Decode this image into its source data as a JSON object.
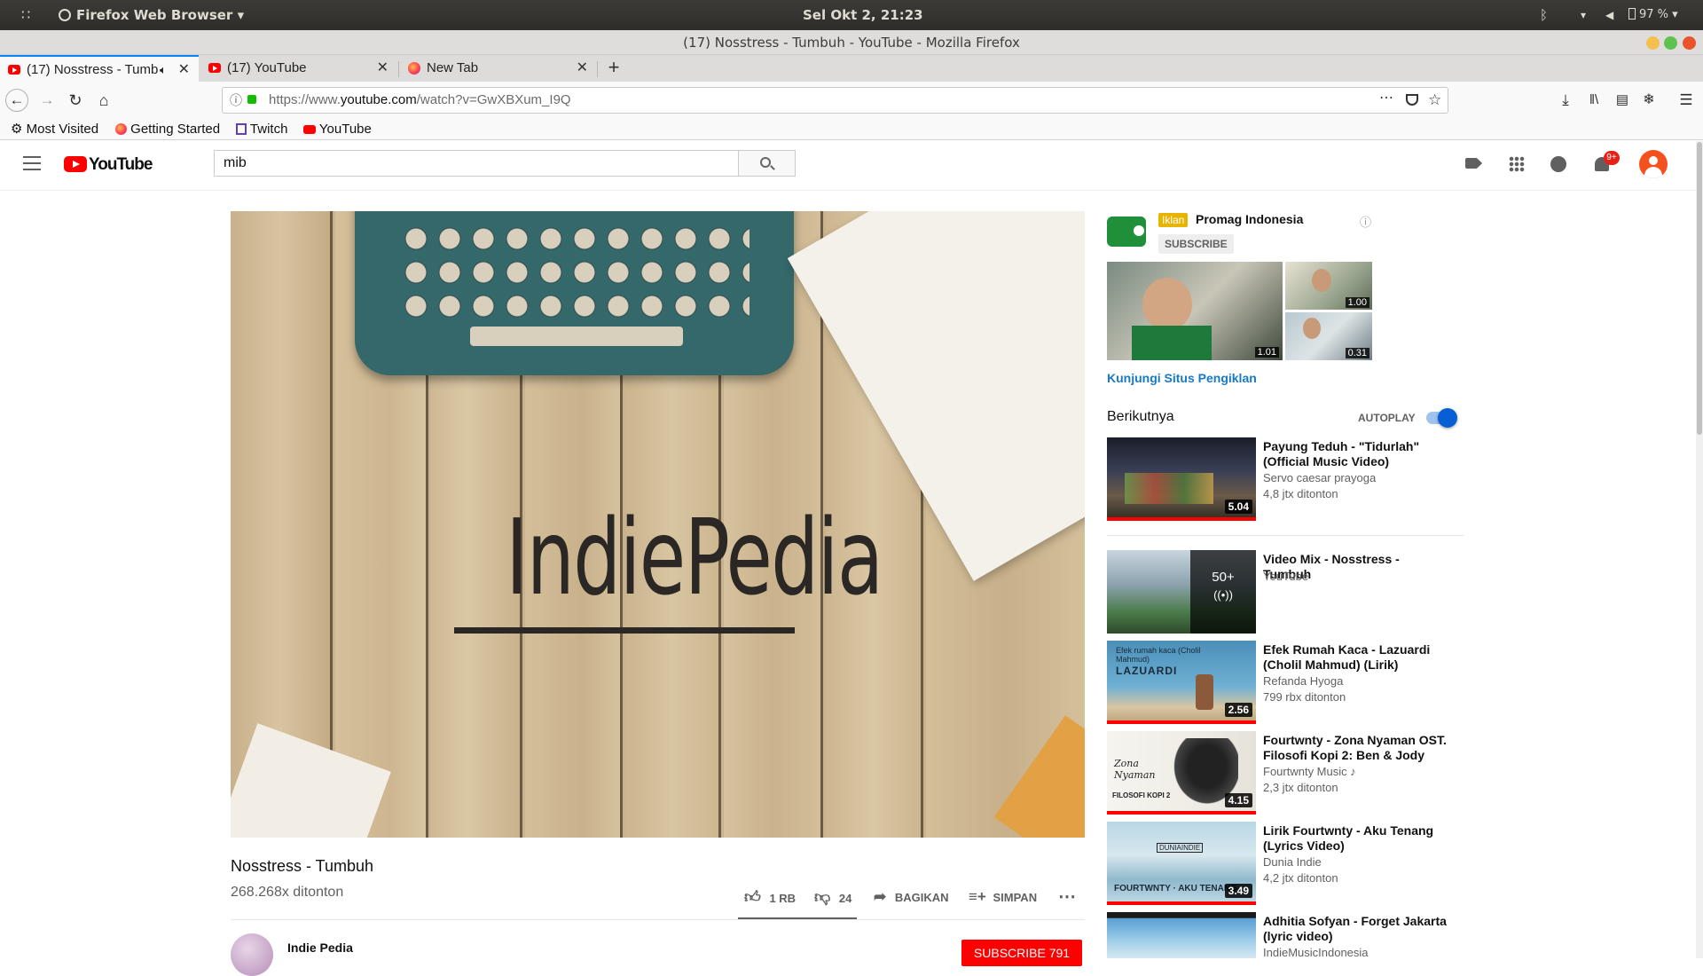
{
  "os_bar": {
    "app_menu": "Firefox Web Browser",
    "clock": "Sel Okt  2, 21:23",
    "battery": "97 %"
  },
  "window": {
    "title": "(17) Nosstress - Tumbuh - YouTube - Mozilla Firefox"
  },
  "tabs": [
    {
      "label": "(17) Nosstress - Tumb"
    },
    {
      "label": "(17) YouTube"
    },
    {
      "label": "New Tab"
    }
  ],
  "url": {
    "prefix": "https://www.",
    "domain": "youtube.com",
    "path": "/watch?v=GwXBXum_I9Q"
  },
  "bookmarks": [
    "Most Visited",
    "Getting Started",
    "Twitch",
    "YouTube"
  ],
  "youtube": {
    "logo": "YouTube",
    "search_value": "mib",
    "notif_count": "9+"
  },
  "video": {
    "overlay_text": "IndiePedia",
    "title": "Nosstress - Tumbuh",
    "views": "268.268x ditonton",
    "likes": "1 RB",
    "dislikes": "24",
    "share": "BAGIKAN",
    "save": "SIMPAN",
    "channel": "Indie Pedia",
    "subscribe": "SUBSCRIBE",
    "subscribers": "791"
  },
  "ad": {
    "badge": "Iklan",
    "advertiser": "Promag Indonesia",
    "subscribe": "SUBSCRIBE",
    "dur1": "1.01",
    "dur2": "1.00",
    "dur3": "0.31",
    "visit_link": "Kunjungi Situs Pengiklan"
  },
  "upnext": {
    "heading": "Berikutnya",
    "autoplay": "AUTOPLAY"
  },
  "recommendations": [
    {
      "title": "Payung Teduh - \"Tidurlah\" (Official Music Video)",
      "channel": "Servo caesar prayoga",
      "views": "4,8 jtx ditonton",
      "duration": "5.04"
    },
    {
      "title": "Video Mix - Nosstress - Tumbuh",
      "channel": "YouTube",
      "count": "50+"
    },
    {
      "title": "Efek Rumah Kaca - Lazuardi (Cholil Mahmud) (Lirik)",
      "channel": "Refanda Hyoga",
      "views": "799 rbx ditonton",
      "duration": "2.56"
    },
    {
      "title": "Fourtwnty - Zona Nyaman OST. Filosofi Kopi 2: Ben & Jody",
      "channel": "Fourtwnty Music",
      "views": "2,3 jtx ditonton",
      "duration": "4.15"
    },
    {
      "title": "Lirik Fourtwnty - Aku Tenang (Lyrics Video)",
      "channel": "Dunia Indie",
      "views": "4,2 jtx ditonton",
      "duration": "3.49"
    },
    {
      "title": "Adhitia Sofyan - Forget Jakarta (lyric video)",
      "channel": "IndieMusicIndonesia"
    }
  ],
  "thumb_text": {
    "lazuardi": "LAZUARDI",
    "lazuardi_small": "Efek rumah kaca (Cholil Mahmud)",
    "zona": "Zona Nyaman",
    "filosofi": "FILOSOFI KOPI 2",
    "aku_tenang": "FOURTWNTY · AKU TENANG",
    "dunia_indie": "DUNIAINDIE"
  },
  "colors": {
    "yt_red": "#ff0000",
    "link_blue": "#167ac6",
    "toggle_blue": "#065fd4",
    "ad_badge": "#e8b400"
  }
}
